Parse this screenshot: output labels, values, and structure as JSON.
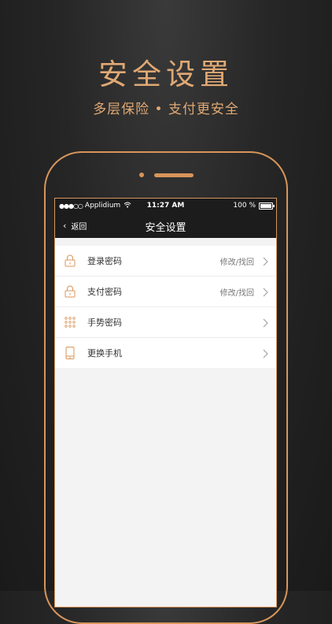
{
  "hero": {
    "title": "安全设置",
    "subtitle": "多层保险 • 支付更安全"
  },
  "status_bar": {
    "carrier": "Applidium",
    "time": "11:27 AM",
    "battery": "100 %"
  },
  "nav": {
    "back_label": "返回",
    "title": "安全设置"
  },
  "settings": [
    {
      "label": "登录密码",
      "hint": "修改/找回",
      "icon": "lock-icon"
    },
    {
      "label": "支付密码",
      "hint": "修改/找回",
      "icon": "lock-icon"
    },
    {
      "label": "手势密码",
      "hint": "",
      "icon": "gesture-grid-icon"
    },
    {
      "label": "更换手机",
      "hint": "",
      "icon": "phone-icon"
    }
  ],
  "colors": {
    "accent": "#e0a974",
    "phone_outline": "#d8955b",
    "bar_bg": "#1c1c1c",
    "list_bg": "#f3f3f3"
  }
}
